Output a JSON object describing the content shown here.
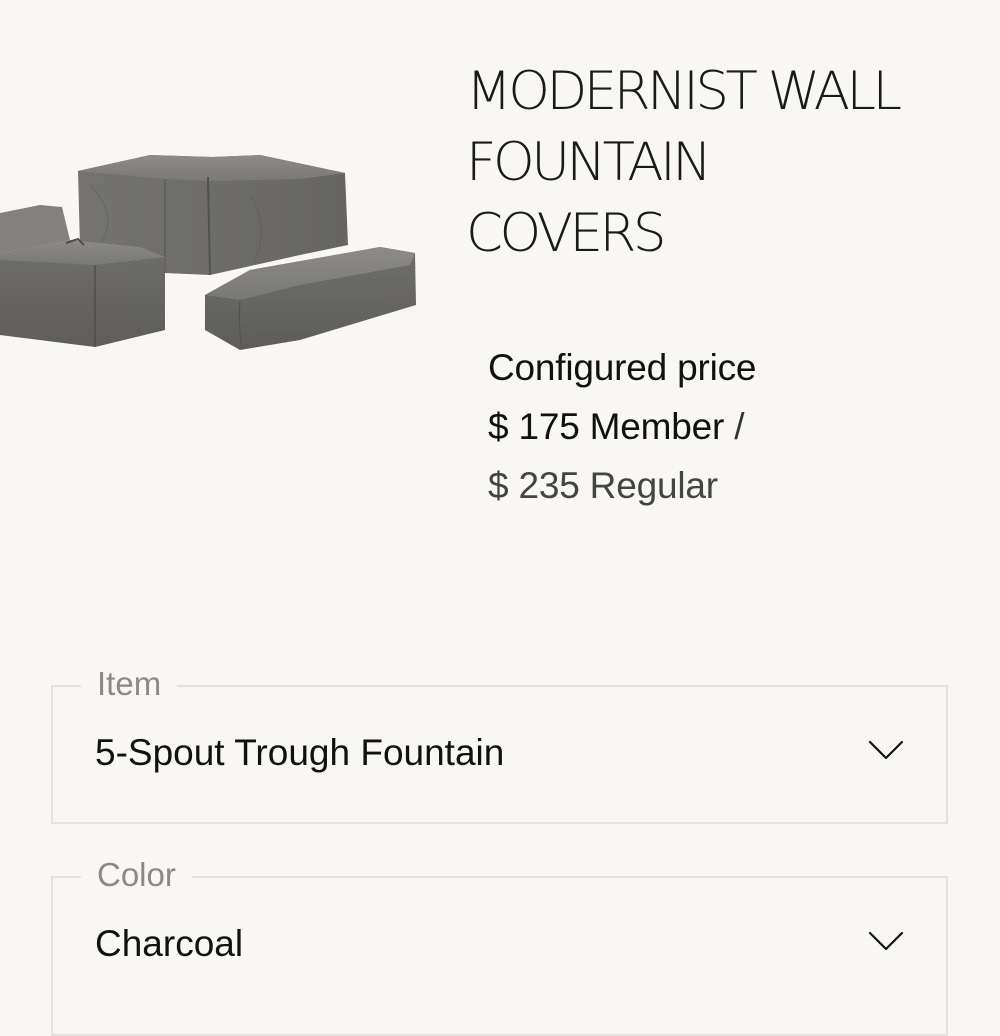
{
  "product": {
    "title_lines": [
      "MODERNIST WALL",
      "FOUNTAIN",
      "COVERS"
    ],
    "image_icon": "covered-furniture-image"
  },
  "price": {
    "label": "Configured price",
    "member": "$ 175 Member",
    "slash": "/",
    "regular": "$ 235 Regular"
  },
  "options": {
    "item": {
      "label": "Item",
      "value": "5-Spout Trough Fountain",
      "icon": "chevron-down-icon"
    },
    "color": {
      "label": "Color",
      "value": "Charcoal",
      "icon": "chevron-down-icon"
    }
  },
  "colors": {
    "background": "#f8f7f4",
    "border": "#e4e2df",
    "legend": "#8d8a86",
    "cover_fabric": "#6f6e6c"
  }
}
